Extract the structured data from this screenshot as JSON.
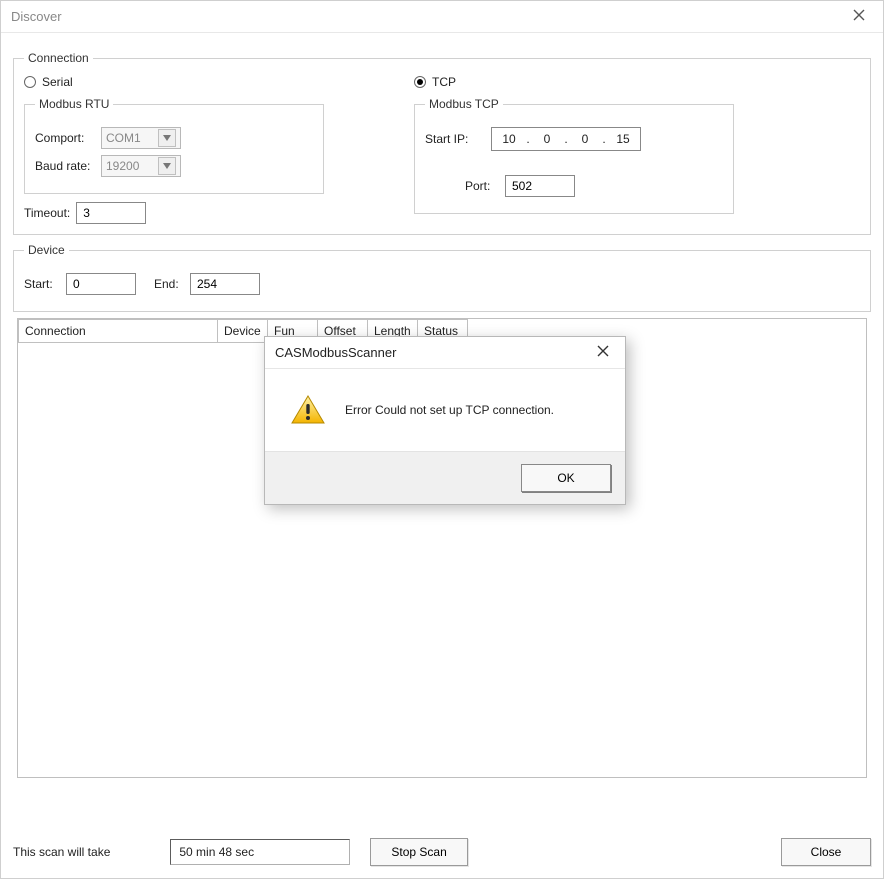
{
  "window": {
    "title": "Discover"
  },
  "connection": {
    "legend": "Connection",
    "serial_label": "Serial",
    "serial_checked": false,
    "tcp_label": "TCP",
    "tcp_checked": true,
    "rtu": {
      "legend": "Modbus RTU",
      "comport_label": "Comport:",
      "comport_value": "COM1",
      "baud_label": "Baud rate:",
      "baud_value": "19200"
    },
    "tcp": {
      "legend": "Modbus TCP",
      "startip_label": "Start IP:",
      "ip": {
        "o1": "10",
        "o2": "0",
        "o3": "0",
        "o4": "15"
      },
      "port_label": "Port:",
      "port_value": "502"
    },
    "timeout_label": "Timeout:",
    "timeout_value": "3"
  },
  "device": {
    "legend": "Device",
    "start_label": "Start:",
    "start_value": "0",
    "end_label": "End:",
    "end_value": "254"
  },
  "table": {
    "headers": {
      "connection": "Connection",
      "device": "Device",
      "fun": "Fun",
      "offset": "Offset",
      "length": "Length",
      "status": "Status"
    }
  },
  "footer": {
    "scan_label": "This scan will take",
    "scan_time": "50 min 48 sec",
    "stop_scan": "Stop Scan",
    "close": "Close"
  },
  "modal": {
    "title": "CASModbusScanner",
    "message": "Error Could not set up TCP connection.",
    "ok": "OK"
  }
}
